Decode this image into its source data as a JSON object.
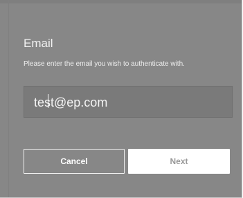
{
  "form": {
    "title": "Email",
    "subtitle": "Please enter the email you wish to authenticate with.",
    "email_value": "test@ep.com"
  },
  "buttons": {
    "cancel_label": "Cancel",
    "next_label": "Next"
  }
}
